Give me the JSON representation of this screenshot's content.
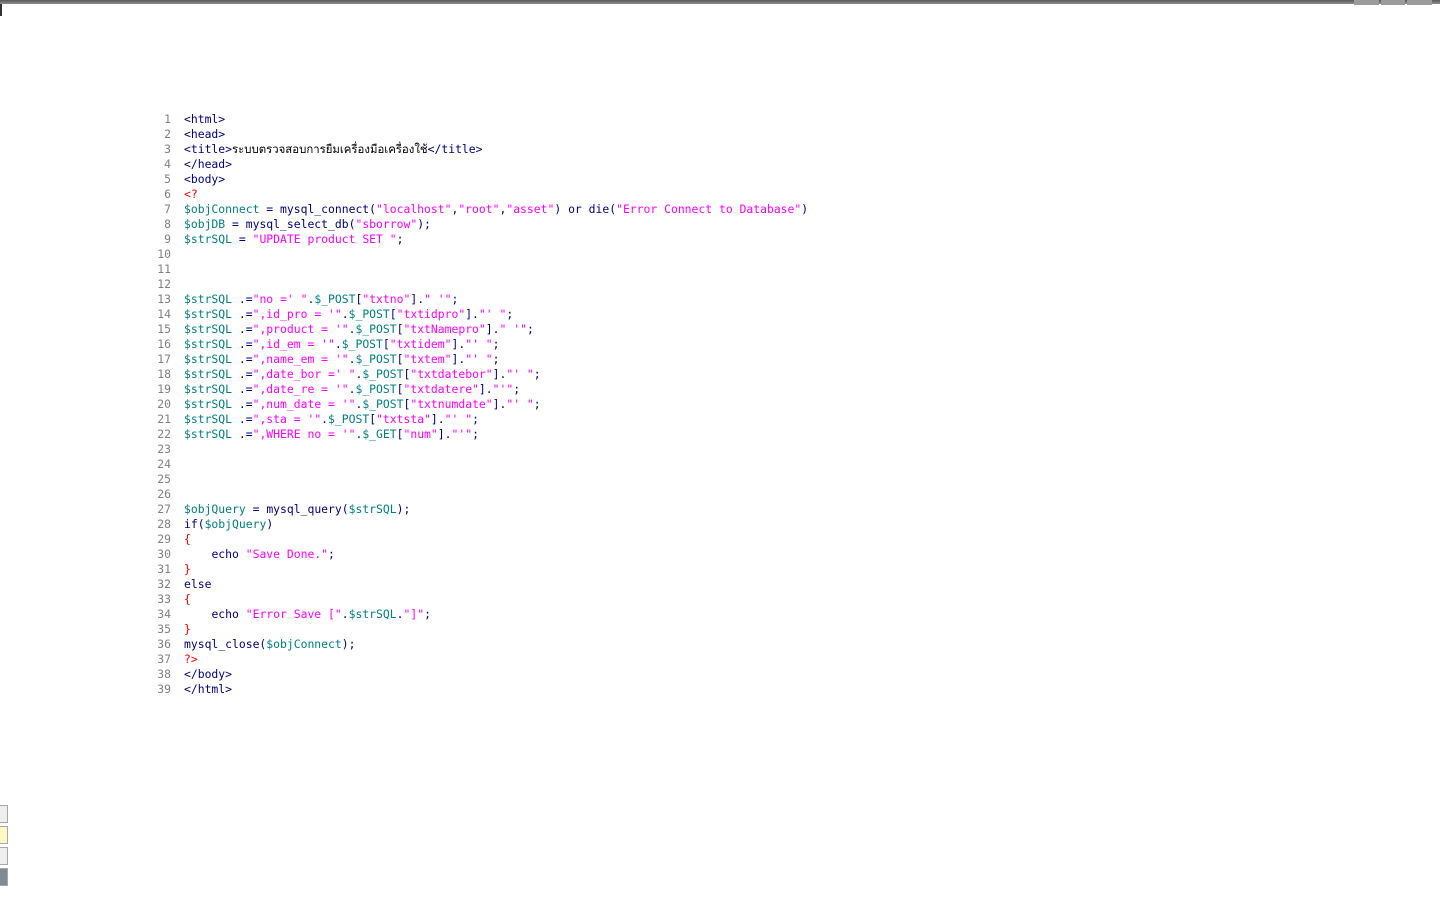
{
  "editor": {
    "lines": [
      {
        "number": "1",
        "tokens": [
          {
            "type": "tag",
            "text": "<html>"
          }
        ]
      },
      {
        "number": "2",
        "tokens": [
          {
            "type": "tag",
            "text": "<head>"
          }
        ]
      },
      {
        "number": "3",
        "tokens": [
          {
            "type": "tag",
            "text": "<title>"
          },
          {
            "type": "text",
            "text": "ระบบตรวจสอบการยืมเครื่องมือเครื่องใช้"
          },
          {
            "type": "tag",
            "text": "</title>"
          }
        ]
      },
      {
        "number": "4",
        "tokens": [
          {
            "type": "tag",
            "text": "</head>"
          }
        ]
      },
      {
        "number": "5",
        "tokens": [
          {
            "type": "tag",
            "text": "<body>"
          }
        ]
      },
      {
        "number": "6",
        "tokens": [
          {
            "type": "php",
            "text": "<?"
          }
        ]
      },
      {
        "number": "7",
        "tokens": [
          {
            "type": "var",
            "text": "$objConnect"
          },
          {
            "type": "op",
            "text": " = "
          },
          {
            "type": "fn",
            "text": "mysql_connect("
          },
          {
            "type": "str",
            "text": "\"localhost\""
          },
          {
            "type": "op",
            "text": ","
          },
          {
            "type": "str",
            "text": "\"root\""
          },
          {
            "type": "op",
            "text": ","
          },
          {
            "type": "str",
            "text": "\"asset\""
          },
          {
            "type": "op",
            "text": ") "
          },
          {
            "type": "kw",
            "text": "or"
          },
          {
            "type": "op",
            "text": " "
          },
          {
            "type": "fn",
            "text": "die("
          },
          {
            "type": "str",
            "text": "\"Error Connect to Database\""
          },
          {
            "type": "op",
            "text": ")"
          }
        ]
      },
      {
        "number": "8",
        "tokens": [
          {
            "type": "var",
            "text": "$objDB"
          },
          {
            "type": "op",
            "text": " = "
          },
          {
            "type": "fn",
            "text": "mysql_select_db("
          },
          {
            "type": "str",
            "text": "\"sborrow\""
          },
          {
            "type": "op",
            "text": ");"
          }
        ]
      },
      {
        "number": "9",
        "tokens": [
          {
            "type": "var",
            "text": "$strSQL"
          },
          {
            "type": "op",
            "text": " = "
          },
          {
            "type": "str",
            "text": "\"UPDATE product SET \""
          },
          {
            "type": "op",
            "text": ";"
          }
        ]
      },
      {
        "number": "10",
        "tokens": []
      },
      {
        "number": "11",
        "tokens": []
      },
      {
        "number": "12",
        "tokens": []
      },
      {
        "number": "13",
        "tokens": [
          {
            "type": "var",
            "text": "$strSQL"
          },
          {
            "type": "op",
            "text": " .="
          },
          {
            "type": "str",
            "text": "\"no =' \""
          },
          {
            "type": "op",
            "text": "."
          },
          {
            "type": "var",
            "text": "$_POST"
          },
          {
            "type": "op",
            "text": "["
          },
          {
            "type": "str",
            "text": "\"txtno\""
          },
          {
            "type": "op",
            "text": "]."
          },
          {
            "type": "str",
            "text": "\" '\""
          },
          {
            "type": "op",
            "text": ";"
          }
        ]
      },
      {
        "number": "14",
        "tokens": [
          {
            "type": "var",
            "text": "$strSQL"
          },
          {
            "type": "op",
            "text": " .="
          },
          {
            "type": "str",
            "text": "\",id_pro = '\""
          },
          {
            "type": "op",
            "text": "."
          },
          {
            "type": "var",
            "text": "$_POST"
          },
          {
            "type": "op",
            "text": "["
          },
          {
            "type": "str",
            "text": "\"txtidpro\""
          },
          {
            "type": "op",
            "text": "]."
          },
          {
            "type": "str",
            "text": "\"' \""
          },
          {
            "type": "op",
            "text": ";"
          }
        ]
      },
      {
        "number": "15",
        "tokens": [
          {
            "type": "var",
            "text": "$strSQL"
          },
          {
            "type": "op",
            "text": " .="
          },
          {
            "type": "str",
            "text": "\",product = '\""
          },
          {
            "type": "op",
            "text": "."
          },
          {
            "type": "var",
            "text": "$_POST"
          },
          {
            "type": "op",
            "text": "["
          },
          {
            "type": "str",
            "text": "\"txtNamepro\""
          },
          {
            "type": "op",
            "text": "]."
          },
          {
            "type": "str",
            "text": "\" '\""
          },
          {
            "type": "op",
            "text": ";"
          }
        ]
      },
      {
        "number": "16",
        "tokens": [
          {
            "type": "var",
            "text": "$strSQL"
          },
          {
            "type": "op",
            "text": " .="
          },
          {
            "type": "str",
            "text": "\",id_em = '\""
          },
          {
            "type": "op",
            "text": "."
          },
          {
            "type": "var",
            "text": "$_POST"
          },
          {
            "type": "op",
            "text": "["
          },
          {
            "type": "str",
            "text": "\"txtidem\""
          },
          {
            "type": "op",
            "text": "]."
          },
          {
            "type": "str",
            "text": "\"' \""
          },
          {
            "type": "op",
            "text": ";"
          }
        ]
      },
      {
        "number": "17",
        "tokens": [
          {
            "type": "var",
            "text": "$strSQL"
          },
          {
            "type": "op",
            "text": " .="
          },
          {
            "type": "str",
            "text": "\",name_em = '\""
          },
          {
            "type": "op",
            "text": "."
          },
          {
            "type": "var",
            "text": "$_POST"
          },
          {
            "type": "op",
            "text": "["
          },
          {
            "type": "str",
            "text": "\"txtem\""
          },
          {
            "type": "op",
            "text": "]."
          },
          {
            "type": "str",
            "text": "\"' \""
          },
          {
            "type": "op",
            "text": ";"
          }
        ]
      },
      {
        "number": "18",
        "tokens": [
          {
            "type": "var",
            "text": "$strSQL"
          },
          {
            "type": "op",
            "text": " .="
          },
          {
            "type": "str",
            "text": "\",date_bor =' \""
          },
          {
            "type": "op",
            "text": "."
          },
          {
            "type": "var",
            "text": "$_POST"
          },
          {
            "type": "op",
            "text": "["
          },
          {
            "type": "str",
            "text": "\"txtdatebor\""
          },
          {
            "type": "op",
            "text": "]."
          },
          {
            "type": "str",
            "text": "\"' \""
          },
          {
            "type": "op",
            "text": ";"
          }
        ]
      },
      {
        "number": "19",
        "tokens": [
          {
            "type": "var",
            "text": "$strSQL"
          },
          {
            "type": "op",
            "text": " .="
          },
          {
            "type": "str",
            "text": "\",date_re = '\""
          },
          {
            "type": "op",
            "text": "."
          },
          {
            "type": "var",
            "text": "$_POST"
          },
          {
            "type": "op",
            "text": "["
          },
          {
            "type": "str",
            "text": "\"txtdatere\""
          },
          {
            "type": "op",
            "text": "]."
          },
          {
            "type": "str",
            "text": "\"'\""
          },
          {
            "type": "op",
            "text": ";"
          }
        ]
      },
      {
        "number": "20",
        "tokens": [
          {
            "type": "var",
            "text": "$strSQL"
          },
          {
            "type": "op",
            "text": " .="
          },
          {
            "type": "str",
            "text": "\",num_date = '\""
          },
          {
            "type": "op",
            "text": "."
          },
          {
            "type": "var",
            "text": "$_POST"
          },
          {
            "type": "op",
            "text": "["
          },
          {
            "type": "str",
            "text": "\"txtnumdate\""
          },
          {
            "type": "op",
            "text": "]."
          },
          {
            "type": "str",
            "text": "\"' \""
          },
          {
            "type": "op",
            "text": ";"
          }
        ]
      },
      {
        "number": "21",
        "tokens": [
          {
            "type": "var",
            "text": "$strSQL"
          },
          {
            "type": "op",
            "text": " .="
          },
          {
            "type": "str",
            "text": "\",sta = '\""
          },
          {
            "type": "op",
            "text": "."
          },
          {
            "type": "var",
            "text": "$_POST"
          },
          {
            "type": "op",
            "text": "["
          },
          {
            "type": "str",
            "text": "\"txtsta\""
          },
          {
            "type": "op",
            "text": "]."
          },
          {
            "type": "str",
            "text": "\"' \""
          },
          {
            "type": "op",
            "text": ";"
          }
        ]
      },
      {
        "number": "22",
        "tokens": [
          {
            "type": "var",
            "text": "$strSQL"
          },
          {
            "type": "op",
            "text": " .="
          },
          {
            "type": "str",
            "text": "\",WHERE no = '\""
          },
          {
            "type": "op",
            "text": "."
          },
          {
            "type": "var",
            "text": "$_GET"
          },
          {
            "type": "op",
            "text": "["
          },
          {
            "type": "str",
            "text": "\"num\""
          },
          {
            "type": "op",
            "text": "]."
          },
          {
            "type": "str",
            "text": "\"'\""
          },
          {
            "type": "op",
            "text": ";"
          }
        ]
      },
      {
        "number": "23",
        "tokens": []
      },
      {
        "number": "24",
        "tokens": []
      },
      {
        "number": "25",
        "tokens": []
      },
      {
        "number": "26",
        "tokens": []
      },
      {
        "number": "27",
        "tokens": [
          {
            "type": "var",
            "text": "$objQuery"
          },
          {
            "type": "op",
            "text": " = "
          },
          {
            "type": "fn",
            "text": "mysql_query("
          },
          {
            "type": "var",
            "text": "$strSQL"
          },
          {
            "type": "op",
            "text": ");"
          }
        ]
      },
      {
        "number": "28",
        "tokens": [
          {
            "type": "kw",
            "text": "if("
          },
          {
            "type": "var",
            "text": "$objQuery"
          },
          {
            "type": "op",
            "text": ")"
          }
        ]
      },
      {
        "number": "29",
        "tokens": [
          {
            "type": "php",
            "text": "{"
          }
        ]
      },
      {
        "number": "30",
        "tokens": [
          {
            "type": "op",
            "text": "    "
          },
          {
            "type": "kw",
            "text": "echo"
          },
          {
            "type": "op",
            "text": " "
          },
          {
            "type": "str",
            "text": "\"Save Done.\""
          },
          {
            "type": "op",
            "text": ";"
          }
        ]
      },
      {
        "number": "31",
        "tokens": [
          {
            "type": "php",
            "text": "}"
          }
        ]
      },
      {
        "number": "32",
        "tokens": [
          {
            "type": "kw",
            "text": "else"
          }
        ]
      },
      {
        "number": "33",
        "tokens": [
          {
            "type": "php",
            "text": "{"
          }
        ]
      },
      {
        "number": "34",
        "tokens": [
          {
            "type": "op",
            "text": "    "
          },
          {
            "type": "kw",
            "text": "echo"
          },
          {
            "type": "op",
            "text": " "
          },
          {
            "type": "str",
            "text": "\"Error Save [\""
          },
          {
            "type": "op",
            "text": "."
          },
          {
            "type": "var",
            "text": "$strSQL"
          },
          {
            "type": "op",
            "text": "."
          },
          {
            "type": "str",
            "text": "\"]\""
          },
          {
            "type": "op",
            "text": ";"
          }
        ]
      },
      {
        "number": "35",
        "tokens": [
          {
            "type": "php",
            "text": "}"
          }
        ]
      },
      {
        "number": "36",
        "tokens": [
          {
            "type": "fn",
            "text": "mysql_close("
          },
          {
            "type": "var",
            "text": "$objConnect"
          },
          {
            "type": "op",
            "text": ");"
          }
        ]
      },
      {
        "number": "37",
        "tokens": [
          {
            "type": "php",
            "text": "?>"
          }
        ]
      },
      {
        "number": "38",
        "tokens": [
          {
            "type": "tag",
            "text": "</body>"
          }
        ]
      },
      {
        "number": "39",
        "tokens": [
          {
            "type": "tag",
            "text": "</html>"
          }
        ]
      }
    ]
  },
  "colors": {
    "line_number": "#808080",
    "tag": "#000080",
    "variable": "#008080",
    "function": "#000080",
    "string": "#ff00ff",
    "keyword": "#000080",
    "operator": "#000080",
    "php_tag": "#ff0000",
    "text": "#000000"
  }
}
